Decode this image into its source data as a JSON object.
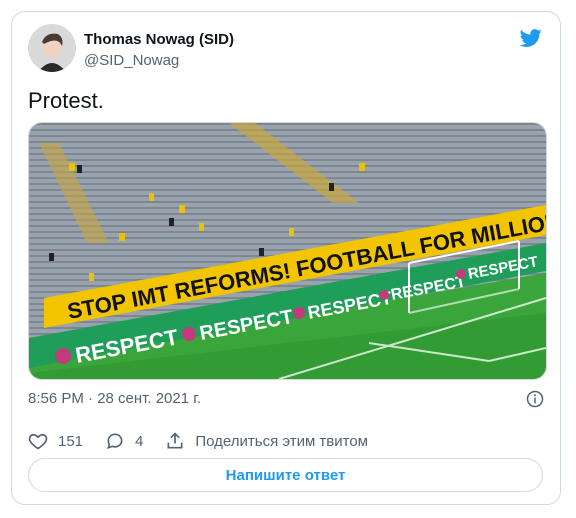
{
  "author": {
    "name": "Thomas Nowag (SID)",
    "handle": "@SID_Nowag"
  },
  "tweet": {
    "text": "Protest.",
    "timestamp": "8:56 PM · 28 сент. 2021 г."
  },
  "media": {
    "banner_text": "STOP IMT REFORMS! FOOTBALL FOR MILLIONS OF FANS - NOT",
    "board_text": "RESPECT"
  },
  "actions": {
    "likes": "151",
    "replies": "4",
    "share_label": "Поделиться этим твитом"
  },
  "reply_button_label": "Напишите ответ",
  "colors": {
    "accent": "#1d9bf0",
    "muted": "#536471",
    "border": "#cfd9de"
  }
}
